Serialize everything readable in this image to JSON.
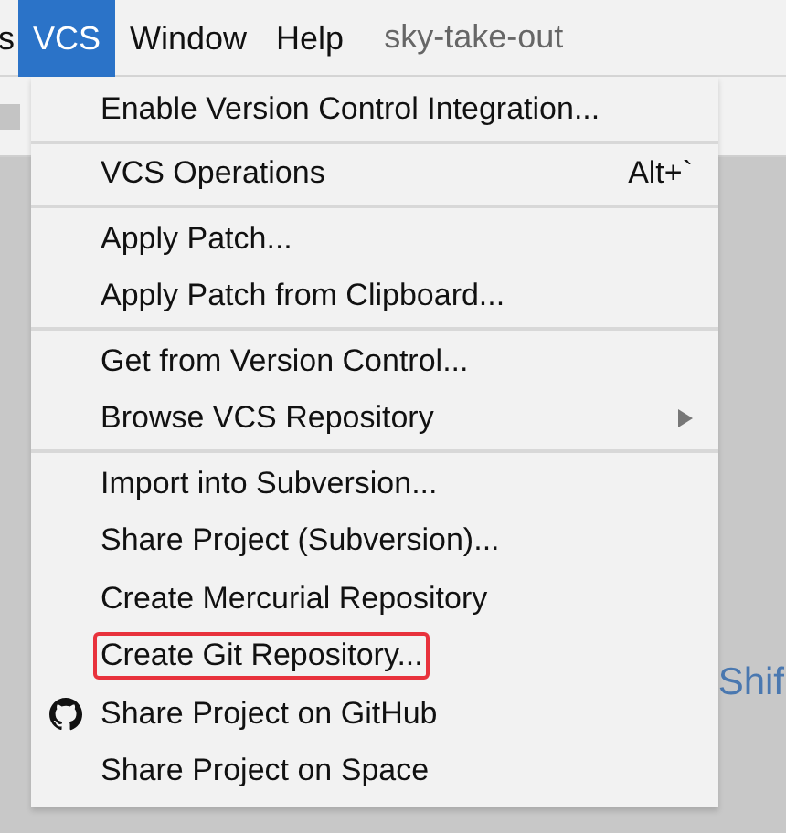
{
  "menubar": [
    {
      "label": "s",
      "selected": false
    },
    {
      "label": "VCS",
      "selected": true
    },
    {
      "label": "Window",
      "selected": false
    },
    {
      "label": "Help",
      "selected": false
    }
  ],
  "project_title": "sky-take-out",
  "background_text": "Shif",
  "menu": {
    "groups": [
      [
        {
          "label": "Enable Version Control Integration...",
          "highlighted": false
        }
      ],
      [
        {
          "label": "VCS Operations",
          "shortcut": "Alt+`",
          "highlighted": false
        }
      ],
      [
        {
          "label": "Apply Patch...",
          "highlighted": false
        },
        {
          "label": "Apply Patch from Clipboard...",
          "highlighted": false
        }
      ],
      [
        {
          "label": "Get from Version Control...",
          "highlighted": false
        },
        {
          "label": "Browse VCS Repository",
          "submenu": true,
          "highlighted": false
        }
      ],
      [
        {
          "label": "Import into Subversion...",
          "highlighted": false
        },
        {
          "label": "Share Project (Subversion)...",
          "highlighted": false
        },
        {
          "label": "Create Mercurial Repository",
          "highlighted": false
        },
        {
          "label": "Create Git Repository...",
          "highlighted": true
        },
        {
          "label": "Share Project on GitHub",
          "icon": true,
          "highlighted": false
        },
        {
          "label": "Share Project on Space",
          "highlighted": false
        }
      ]
    ]
  }
}
